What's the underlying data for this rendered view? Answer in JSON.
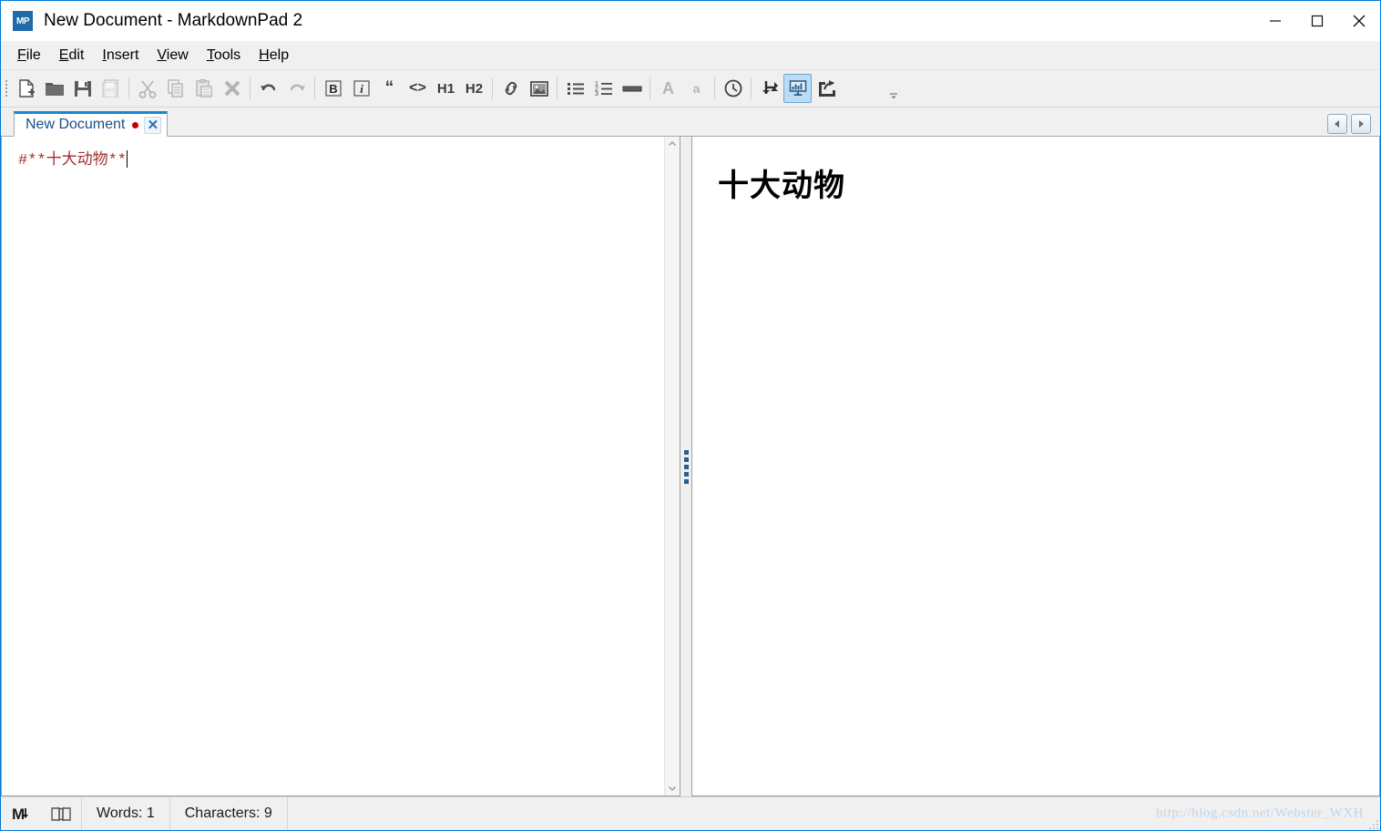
{
  "window": {
    "title": "New Document - MarkdownPad 2",
    "app_icon_text": "MP",
    "controls": {
      "minimize": "minimize-button",
      "maximize": "maximize-button",
      "close": "close-button"
    },
    "accent_color": "#0078d7"
  },
  "menubar": {
    "items": [
      {
        "label": "File",
        "mnemonic": "F"
      },
      {
        "label": "Edit",
        "mnemonic": "E"
      },
      {
        "label": "Insert",
        "mnemonic": "I"
      },
      {
        "label": "View",
        "mnemonic": "V"
      },
      {
        "label": "Tools",
        "mnemonic": "T"
      },
      {
        "label": "Help",
        "mnemonic": "H"
      }
    ]
  },
  "toolbar": {
    "overflow_label": "toolbar-overflow",
    "groups": [
      {
        "buttons": [
          {
            "icon": "new-document-icon",
            "label": "New Document",
            "enabled": true
          },
          {
            "icon": "open-folder-icon",
            "label": "Open",
            "enabled": true
          },
          {
            "icon": "save-icon",
            "label": "Save",
            "enabled": true
          },
          {
            "icon": "save-as-icon",
            "label": "Save As",
            "enabled": false
          }
        ]
      },
      {
        "buttons": [
          {
            "icon": "cut-icon",
            "label": "Cut",
            "enabled": false
          },
          {
            "icon": "copy-icon",
            "label": "Copy",
            "enabled": false
          },
          {
            "icon": "paste-icon",
            "label": "Paste",
            "enabled": false
          },
          {
            "icon": "delete-icon",
            "label": "Delete",
            "enabled": false
          }
        ]
      },
      {
        "buttons": [
          {
            "icon": "undo-icon",
            "label": "Undo",
            "enabled": true
          },
          {
            "icon": "redo-icon",
            "label": "Redo",
            "enabled": false
          }
        ]
      },
      {
        "buttons": [
          {
            "icon": "bold-icon",
            "label": "Bold",
            "enabled": true,
            "text": "B"
          },
          {
            "icon": "italic-icon",
            "label": "Italic",
            "enabled": true,
            "text": "i"
          },
          {
            "icon": "blockquote-icon",
            "label": "Blockquote",
            "enabled": true,
            "text": "“"
          },
          {
            "icon": "inline-code-icon",
            "label": "Inline Code",
            "enabled": true,
            "text": "<>"
          },
          {
            "icon": "heading-1-icon",
            "label": "H1",
            "enabled": true,
            "text": "H1"
          },
          {
            "icon": "heading-2-icon",
            "label": "H2",
            "enabled": true,
            "text": "H2"
          }
        ]
      },
      {
        "buttons": [
          {
            "icon": "link-icon",
            "label": "Insert Link",
            "enabled": true
          },
          {
            "icon": "image-icon",
            "label": "Insert Image",
            "enabled": true
          }
        ]
      },
      {
        "buttons": [
          {
            "icon": "bulleted-list-icon",
            "label": "Bulleted List",
            "enabled": true
          },
          {
            "icon": "numbered-list-icon",
            "label": "Numbered List",
            "enabled": true
          },
          {
            "icon": "horizontal-rule-icon",
            "label": "Horizontal Rule",
            "enabled": true
          }
        ]
      },
      {
        "buttons": [
          {
            "icon": "increase-font-icon",
            "label": "Increase Font Size",
            "enabled": false,
            "text": "A"
          },
          {
            "icon": "decrease-font-icon",
            "label": "Decrease Font Size",
            "enabled": false,
            "text": "a"
          }
        ]
      },
      {
        "buttons": [
          {
            "icon": "timestamp-icon",
            "label": "Insert Timestamp",
            "enabled": true
          }
        ]
      },
      {
        "buttons": [
          {
            "icon": "line-break-icon",
            "label": "Line Break",
            "enabled": true
          },
          {
            "icon": "live-preview-icon",
            "label": "Live Preview",
            "enabled": true,
            "active": true
          },
          {
            "icon": "export-icon",
            "label": "Export",
            "enabled": true
          }
        ]
      }
    ]
  },
  "tabs": {
    "active_index": 0,
    "items": [
      {
        "label": "New Document",
        "dirty": true,
        "close_label": "✕"
      }
    ],
    "scroll_left_label": "◀",
    "scroll_right_label": "▶"
  },
  "editor": {
    "content": "#**十大动物**",
    "text_color": "#a03030",
    "scroll_up_label": "⌃",
    "scroll_down_label": "⌄"
  },
  "preview": {
    "heading": "十大动物"
  },
  "statusbar": {
    "markdown_icon": "M",
    "book_icon": "book-icon",
    "words": "Words: 1",
    "characters": "Characters: 9",
    "watermark": "http://blog.csdn.net/Webster_WXH"
  }
}
